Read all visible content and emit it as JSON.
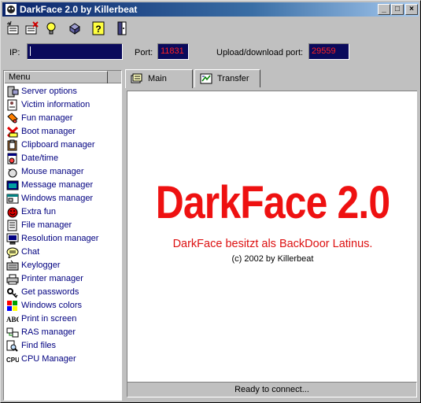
{
  "window": {
    "title": "DarkFace 2.0 by Killerbeat"
  },
  "titlebar_buttons": [
    "_",
    "□",
    "×"
  ],
  "toolbar": [
    "new-connection-icon",
    "disconnect-icon",
    "idea-icon",
    "settings-icon",
    "help-icon",
    "exit-icon"
  ],
  "connection": {
    "ip_label": "IP:",
    "ip_value": "",
    "port_label": "Port:",
    "port_value": "11831",
    "transfer_port_label": "Upload/download port:",
    "transfer_port_value": "29559"
  },
  "menu": {
    "header": "Menu",
    "items": [
      {
        "label": "Server options",
        "icon": "server-icon"
      },
      {
        "label": "Victim information",
        "icon": "victim-icon"
      },
      {
        "label": "Fun manager",
        "icon": "fun-icon"
      },
      {
        "label": "Boot manager",
        "icon": "boot-icon"
      },
      {
        "label": "Clipboard manager",
        "icon": "clipboard-icon"
      },
      {
        "label": "Date/time",
        "icon": "calendar-icon"
      },
      {
        "label": "Mouse manager",
        "icon": "mouse-icon"
      },
      {
        "label": "Message manager",
        "icon": "message-icon"
      },
      {
        "label": "Windows manager",
        "icon": "windows-icon"
      },
      {
        "label": "Extra fun",
        "icon": "extra-fun-icon"
      },
      {
        "label": "File manager",
        "icon": "file-icon"
      },
      {
        "label": "Resolution manager",
        "icon": "monitor-icon"
      },
      {
        "label": "Chat",
        "icon": "chat-icon"
      },
      {
        "label": "Keylogger",
        "icon": "keyboard-icon"
      },
      {
        "label": "Printer manager",
        "icon": "printer-icon"
      },
      {
        "label": "Get passwords",
        "icon": "key-icon"
      },
      {
        "label": "Windows colors",
        "icon": "palette-icon"
      },
      {
        "label": "Print in screen",
        "icon": "abc-icon"
      },
      {
        "label": "RAS manager",
        "icon": "network-icon"
      },
      {
        "label": "Find files",
        "icon": "search-icon"
      },
      {
        "label": "CPU Manager",
        "icon": "cpu-icon"
      }
    ]
  },
  "tabs": [
    {
      "label": "Main",
      "icon": "main-tab-icon"
    },
    {
      "label": "Transfer",
      "icon": "transfer-tab-icon"
    }
  ],
  "main": {
    "title": "DarkFace 2.0",
    "subtitle": "DarkFace besitzt als BackDoor Latinus.",
    "copyright": "(c) 2002 by Killerbeat"
  },
  "status": "Ready to connect...",
  "colors": {
    "accent_red": "#ee1111",
    "title_blue": "#0a246a",
    "field_bg": "#0a0a5c",
    "link_blue": "#000080"
  }
}
